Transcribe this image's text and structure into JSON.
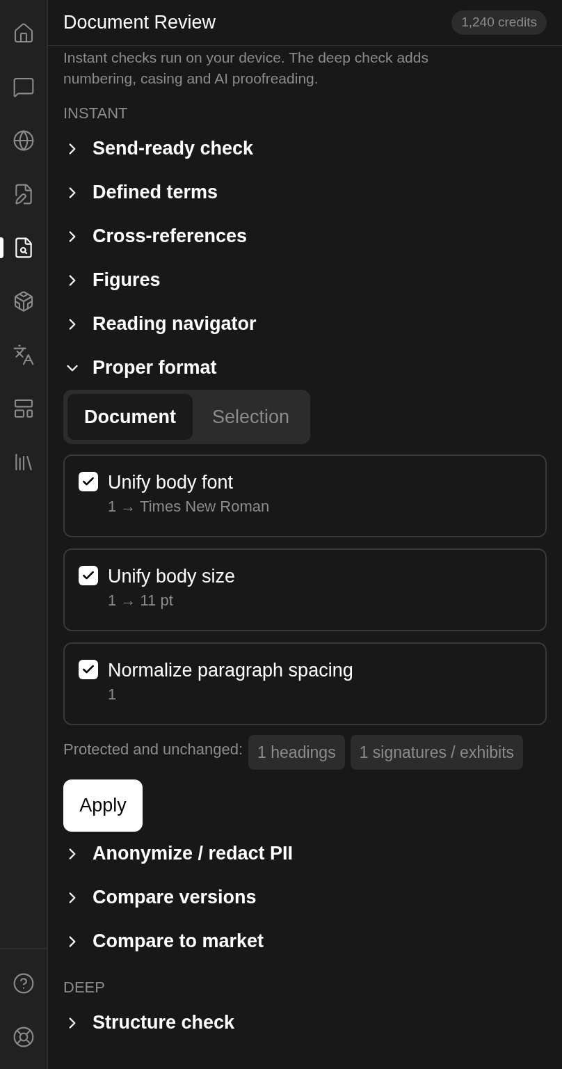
{
  "sidebar": {
    "items": [
      {
        "selected": false
      },
      {
        "selected": false
      },
      {
        "selected": false
      },
      {
        "selected": false
      },
      {
        "selected": true
      },
      {
        "selected": false
      },
      {
        "selected": false
      },
      {
        "selected": false
      },
      {
        "selected": false
      }
    ],
    "bottom_items": [
      {
        "selected": false
      },
      {
        "selected": false
      }
    ]
  },
  "header": {
    "title": "Document Review",
    "credits": "1,240 credits"
  },
  "intro": "Instant checks run on your device. The deep check adds numbering, casing and AI proofreading.",
  "sections": [
    {
      "kind": "label",
      "text": "INSTANT"
    },
    {
      "kind": "accordion",
      "title": "Send-ready check",
      "expanded": false
    },
    {
      "kind": "accordion",
      "title": "Defined terms",
      "expanded": false
    },
    {
      "kind": "accordion",
      "title": "Cross-references",
      "expanded": false
    },
    {
      "kind": "accordion",
      "title": "Figures",
      "expanded": false
    },
    {
      "kind": "accordion",
      "title": "Reading navigator",
      "expanded": false
    },
    {
      "kind": "accordion",
      "title": "Proper format",
      "expanded": true,
      "content": {
        "tabs": [
          {
            "label": "Document",
            "selected": true
          },
          {
            "label": "Selection",
            "selected": false
          }
        ],
        "options": [
          {
            "title": "Unify body font",
            "detail": "1 → Times New Roman",
            "checked": true
          },
          {
            "title": "Unify body size",
            "detail": "1 → 11 pt",
            "checked": true
          },
          {
            "title": "Normalize paragraph spacing",
            "detail": "1",
            "checked": true
          }
        ],
        "protected_label": "Protected and unchanged:",
        "protected_tags": [
          "1 headings",
          "1 signatures / exhibits"
        ],
        "apply_button": "Apply"
      }
    },
    {
      "kind": "accordion",
      "title": "Anonymize / redact PII",
      "expanded": false
    },
    {
      "kind": "accordion",
      "title": "Compare versions",
      "expanded": false
    },
    {
      "kind": "accordion",
      "title": "Compare to market",
      "expanded": false
    },
    {
      "kind": "label",
      "text": "DEEP"
    },
    {
      "kind": "accordion",
      "title": "Structure check",
      "expanded": false
    }
  ]
}
